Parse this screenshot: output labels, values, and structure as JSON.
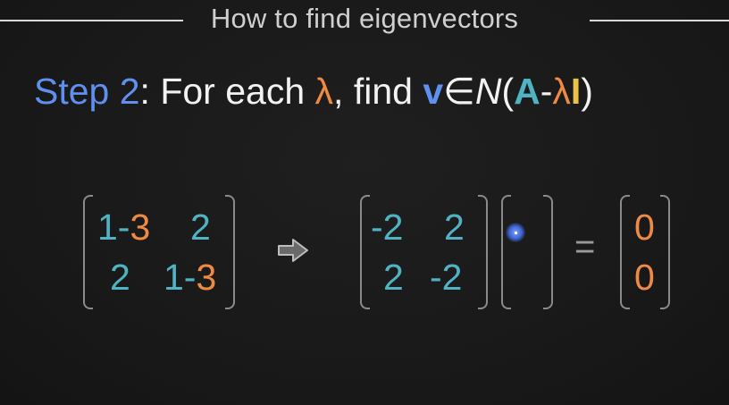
{
  "title": "How to find eigenvectors",
  "step": {
    "label": "Step 2",
    "colon": ": For each ",
    "lambda": "λ",
    "mid": ", find ",
    "v": "v",
    "elem": "∈",
    "N": "N",
    "open": "(",
    "A": "A",
    "minus": "-",
    "lambda2": "λ",
    "I": "I",
    "close": ")"
  },
  "matrix1": {
    "r1c1a": "1-",
    "r1c1b": "3",
    "r1c2": "2",
    "r2c1": "2",
    "r2c2a": "1-",
    "r2c2b": "3"
  },
  "arrow_icon": "right-arrow-icon",
  "matrix2": {
    "r1c1": "-2",
    "r1c2": "2",
    "r2c1": "2",
    "r2c2": "-2"
  },
  "equals": "=",
  "zero_vector": {
    "r1": "0",
    "r2": "0"
  },
  "colors": {
    "blue": "#5f8fef",
    "orange": "#ef8a45",
    "teal": "#4fb3c4",
    "yellow": "#e9c24a"
  }
}
